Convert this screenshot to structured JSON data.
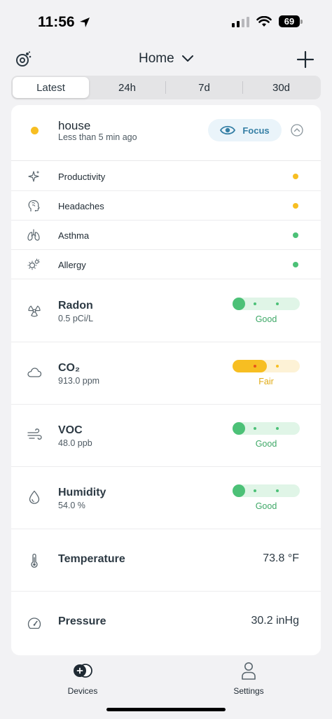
{
  "status": {
    "time": "11:56",
    "battery": "69"
  },
  "nav": {
    "title": "Home"
  },
  "tabs": [
    "Latest",
    "24h",
    "7d",
    "30d"
  ],
  "house": {
    "name": "house",
    "subtitle": "Less than 5 min ago",
    "focus_label": "Focus"
  },
  "symptoms": [
    {
      "label": "Productivity",
      "status_color": "#f7be22"
    },
    {
      "label": "Headaches",
      "status_color": "#f7be22"
    },
    {
      "label": "Asthma",
      "status_color": "#4cc177"
    },
    {
      "label": "Allergy",
      "status_color": "#4cc177"
    }
  ],
  "metrics": [
    {
      "name": "Radon",
      "value": "0.5 pCi/L",
      "rating": "Good",
      "level": 1
    },
    {
      "name": "CO₂",
      "value": "913.0 ppm",
      "rating": "Fair",
      "level": 2
    },
    {
      "name": "VOC",
      "value": "48.0 ppb",
      "rating": "Good",
      "level": 1
    },
    {
      "name": "Humidity",
      "value": "54.0 %",
      "rating": "Good",
      "level": 1
    }
  ],
  "readings": [
    {
      "name": "Temperature",
      "value": "73.8 °F"
    },
    {
      "name": "Pressure",
      "value": "30.2 inHg"
    }
  ],
  "colors": {
    "good": "#4cc177",
    "good_track": "#e0f5e7",
    "good_text": "#3ea867",
    "fair": "#f7be22",
    "fair_track": "#fdf2d6",
    "fair_text": "#e0aa14",
    "accent": "#357fa5"
  },
  "bottom_tabs": {
    "devices": "Devices",
    "settings": "Settings"
  }
}
